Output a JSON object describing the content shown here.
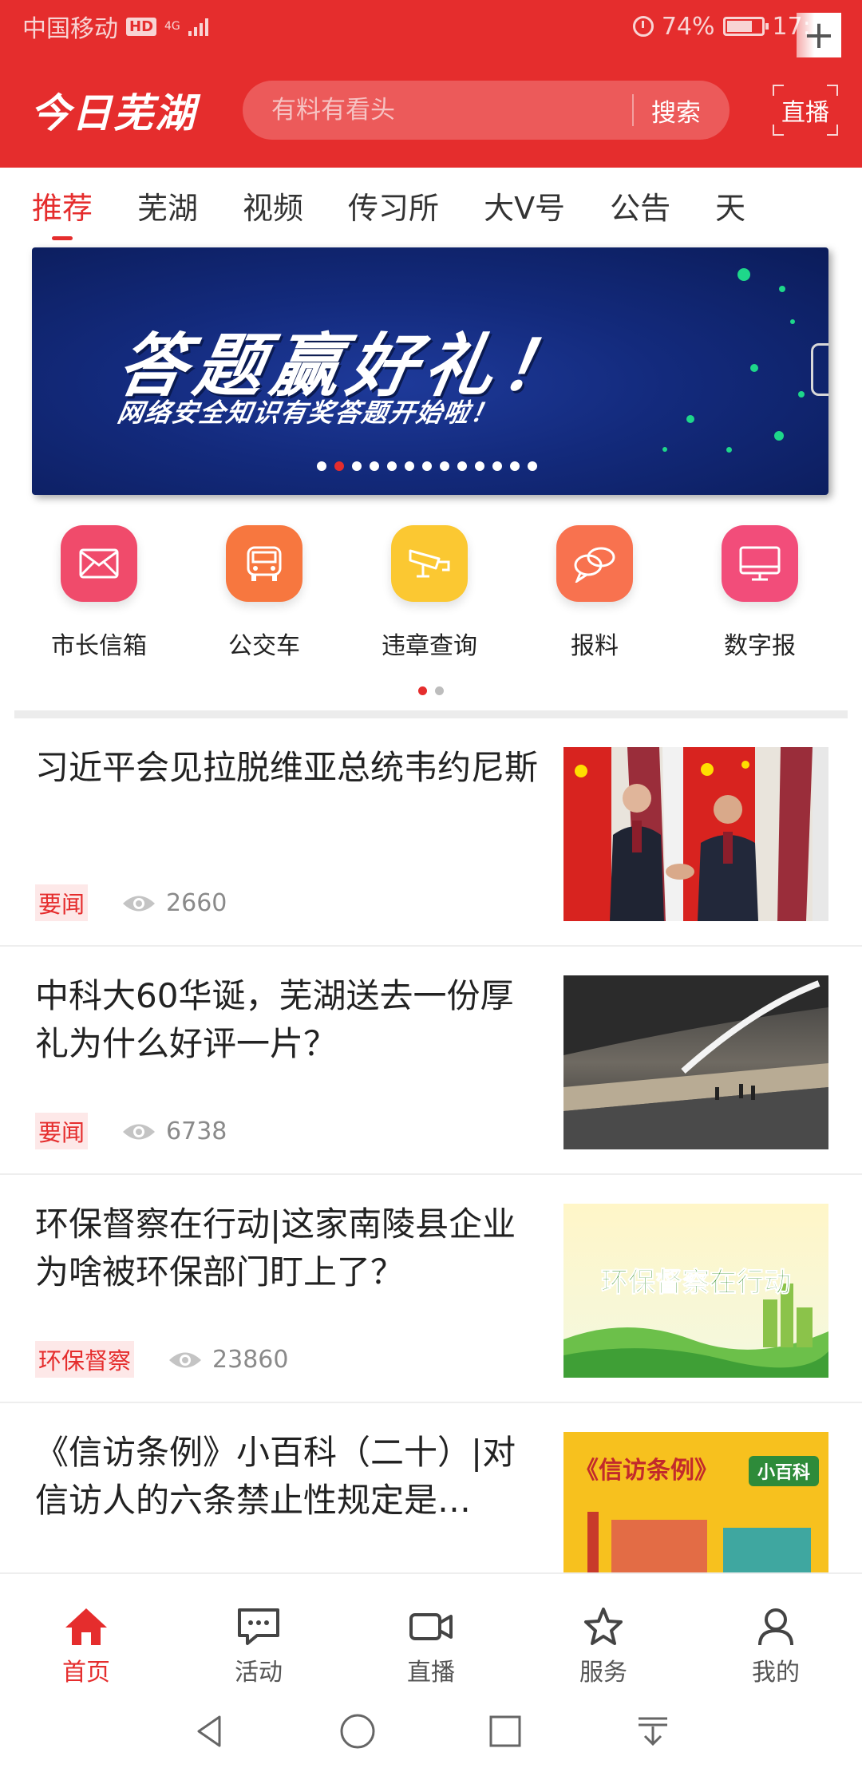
{
  "status_bar": {
    "carrier": "中国移动",
    "hd": "HD",
    "network": "4G",
    "battery_percent": "74%",
    "battery_level": 0.74,
    "time": "17:54"
  },
  "header": {
    "logo": "今日芜湖",
    "search_placeholder": "有料有看头",
    "search_button": "搜索",
    "live_button": "直播"
  },
  "tabs": [
    "推荐",
    "芜湖",
    "视频",
    "传习所",
    "大V号",
    "公告",
    "天"
  ],
  "active_tab": "推荐",
  "banner": {
    "title": "答题赢好礼！",
    "subtitle": "网络安全知识有奖答题开始啦！",
    "page_count": 13,
    "active_page": 2
  },
  "services": [
    {
      "label": "市长信箱",
      "icon": "mail-icon",
      "color": "#f04b6b"
    },
    {
      "label": "公交车",
      "icon": "bus-icon",
      "color": "#f7773f"
    },
    {
      "label": "违章查询",
      "icon": "camera-icon",
      "color": "#fbc832"
    },
    {
      "label": "报料",
      "icon": "chat-bubbles-icon",
      "color": "#f8724f"
    },
    {
      "label": "数字报",
      "icon": "monitor-icon",
      "color": "#f24d7a"
    }
  ],
  "services_pages": 2,
  "services_active_page": 1,
  "news": [
    {
      "title": "习近平会见拉脱维亚总统韦约尼斯",
      "tag": "要闻",
      "views": "2660"
    },
    {
      "title": "中科大60华诞，芜湖送去一份厚礼为什么好评一片？",
      "tag": "要闻",
      "views": "6738"
    },
    {
      "title": "环保督察在行动|这家南陵县企业为啥被环保部门盯上了？",
      "tag": "环保督察",
      "views": "23860",
      "thumb_text": "环保督察在行动"
    },
    {
      "title": "《信访条例》小百科（二十）|对信访人的六条禁止性规定是…",
      "tag": "",
      "views": "",
      "thumb_text": "《信访条例》",
      "thumb_badge": "小百科"
    }
  ],
  "bottom_nav": [
    {
      "label": "首页",
      "icon": "home-icon"
    },
    {
      "label": "活动",
      "icon": "chat-icon"
    },
    {
      "label": "直播",
      "icon": "video-camera-icon"
    },
    {
      "label": "服务",
      "icon": "star-icon"
    },
    {
      "label": "我的",
      "icon": "user-icon"
    }
  ],
  "colors": {
    "brand_red": "#e52d2d",
    "tag_bg": "#fde8e8"
  }
}
